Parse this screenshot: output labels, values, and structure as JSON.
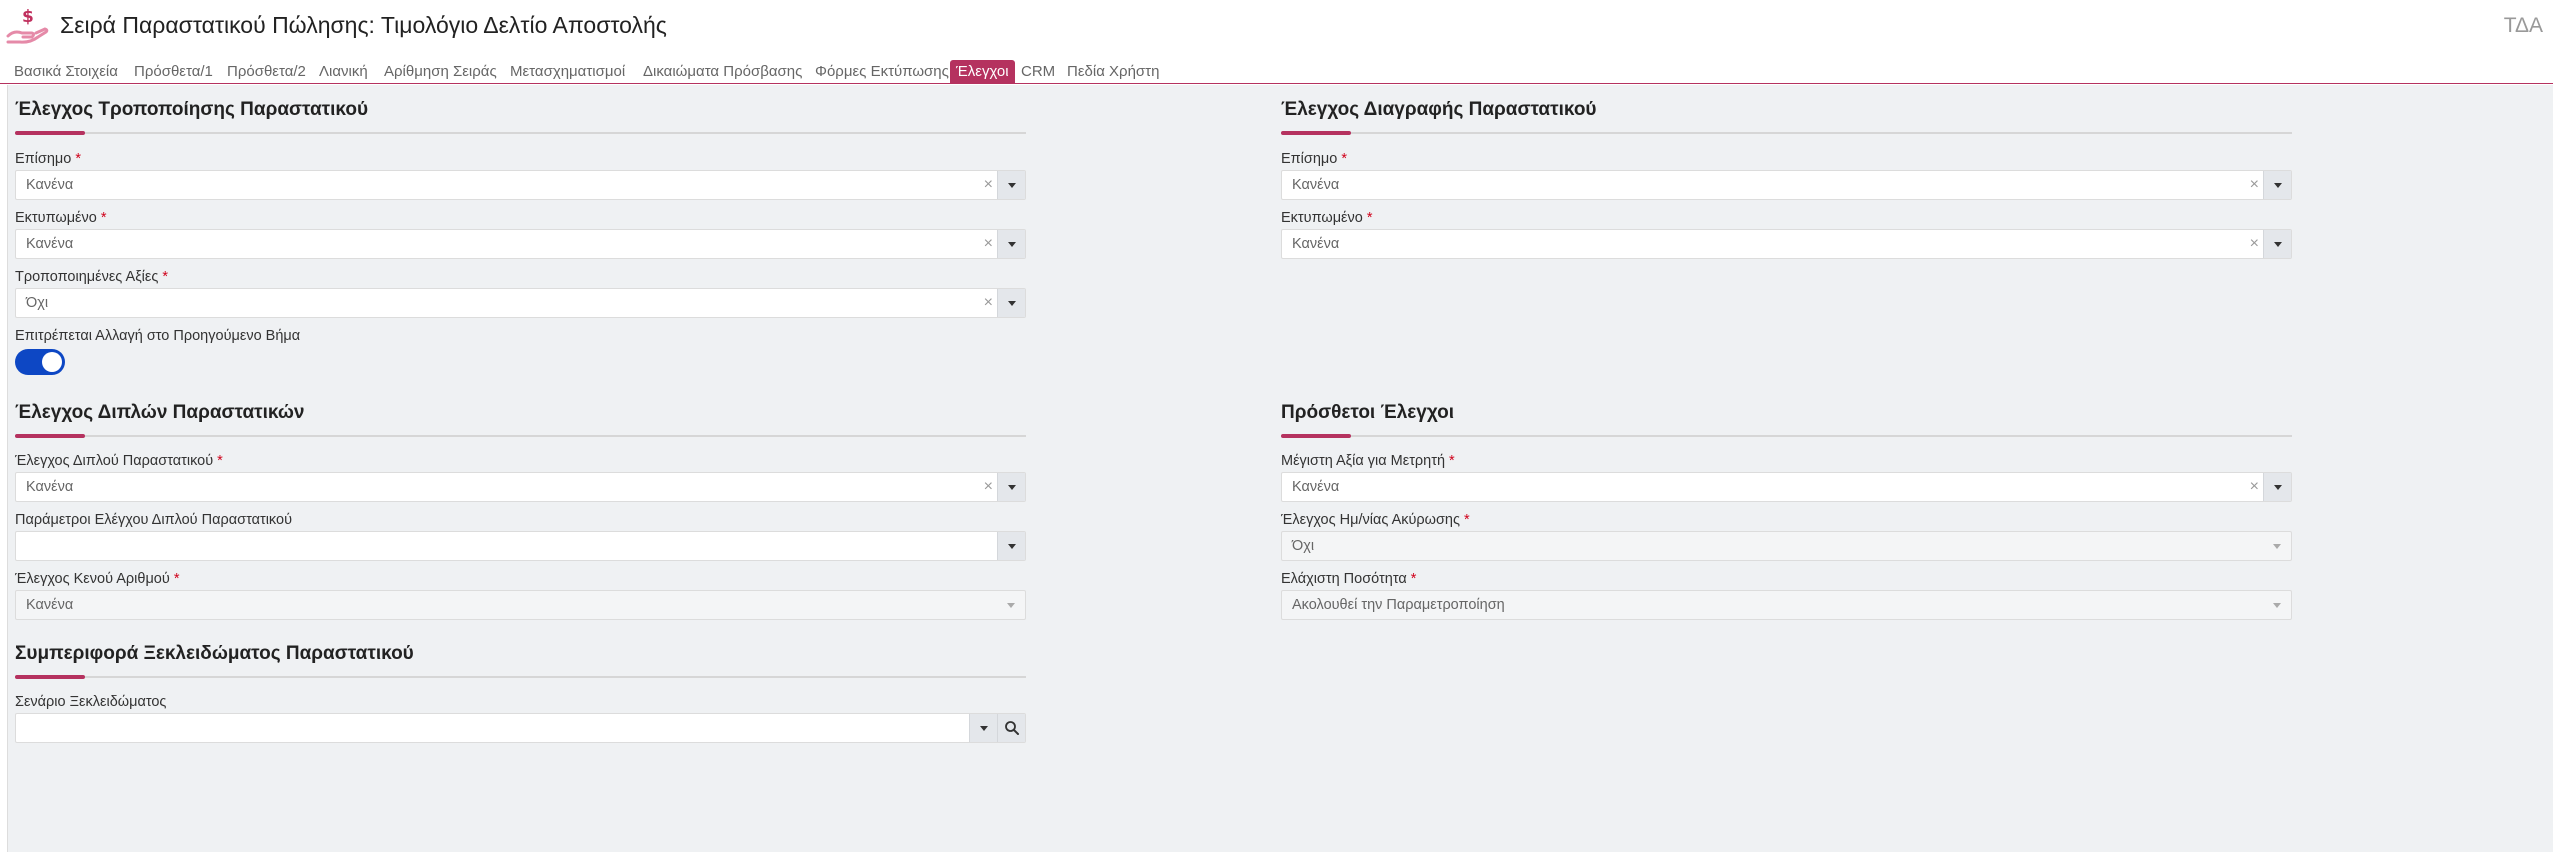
{
  "header": {
    "title": "Σειρά Παραστατικού Πώλησης: Τιμολόγιο Δελτίο Αποστολής",
    "user": "ΤΔΑ"
  },
  "tabs": [
    "Βασικά Στοιχεία",
    "Πρόσθετα/1",
    "Πρόσθετα/2",
    "Λιανική",
    "Αρίθμηση Σειράς",
    "Μετασχηματισμοί",
    "Δικαιώματα Πρόσβασης",
    "Φόρμες Εκτύπωσης",
    "Έλεγχοι",
    "CRM",
    "Πεδία Χρήστη"
  ],
  "active_tab": "Έλεγχοι",
  "required_mark": "*",
  "sections": {
    "modify": {
      "title": "Έλεγχος Τροποποίησης Παραστατικού",
      "official": {
        "label": "Επίσημο",
        "value": "Κανένα"
      },
      "printed": {
        "label": "Εκτυπωμένο",
        "value": "Κανένα"
      },
      "modified_values": {
        "label": "Τροποποιημένες Αξίες",
        "value": "Όχι"
      },
      "allow_prev_step": {
        "label": "Επιτρέπεται Αλλαγή στο Προηγούμενο Βήμα",
        "on": true
      }
    },
    "delete": {
      "title": "Έλεγχος Διαγραφής Παραστατικού",
      "official": {
        "label": "Επίσημο",
        "value": "Κανένα"
      },
      "printed": {
        "label": "Εκτυπωμένο",
        "value": "Κανένα"
      }
    },
    "duplicates": {
      "title": "Έλεγχος Διπλών Παραστατικών",
      "dup_check": {
        "label": "Έλεγχος Διπλού Παραστατικού",
        "value": "Κανένα"
      },
      "dup_params": {
        "label": "Παράμετροι Ελέγχου Διπλού Παραστατικού",
        "value": ""
      },
      "empty_number": {
        "label": "Έλεγχος Κενού Αριθμού",
        "value": "Κανένα"
      }
    },
    "extra": {
      "title": "Πρόσθετοι Έλεγχοι",
      "max_counter": {
        "label": "Μέγιστη Αξία για Μετρητή",
        "value": "Κανένα"
      },
      "cancel_date": {
        "label": "Έλεγχος Ημ/νίας Ακύρωσης",
        "value": "Όχι"
      },
      "min_qty": {
        "label": "Ελάχιστη Ποσότητα",
        "value": "Ακολουθεί την Παραμετροποίηση"
      }
    },
    "unlock": {
      "title": "Συμπεριφορά Ξεκλειδώματος Παραστατικού",
      "scenario": {
        "label": "Σενάριο Ξεκλειδώματος",
        "value": ""
      }
    }
  },
  "colors": {
    "accent": "#b5325f",
    "toggle": "#0d47c4",
    "background": "#eff1f3"
  },
  "icons": {
    "logo": "money-hand-icon",
    "clear": "clear-icon",
    "dropdown": "chevron-down-icon",
    "search": "search-icon"
  }
}
